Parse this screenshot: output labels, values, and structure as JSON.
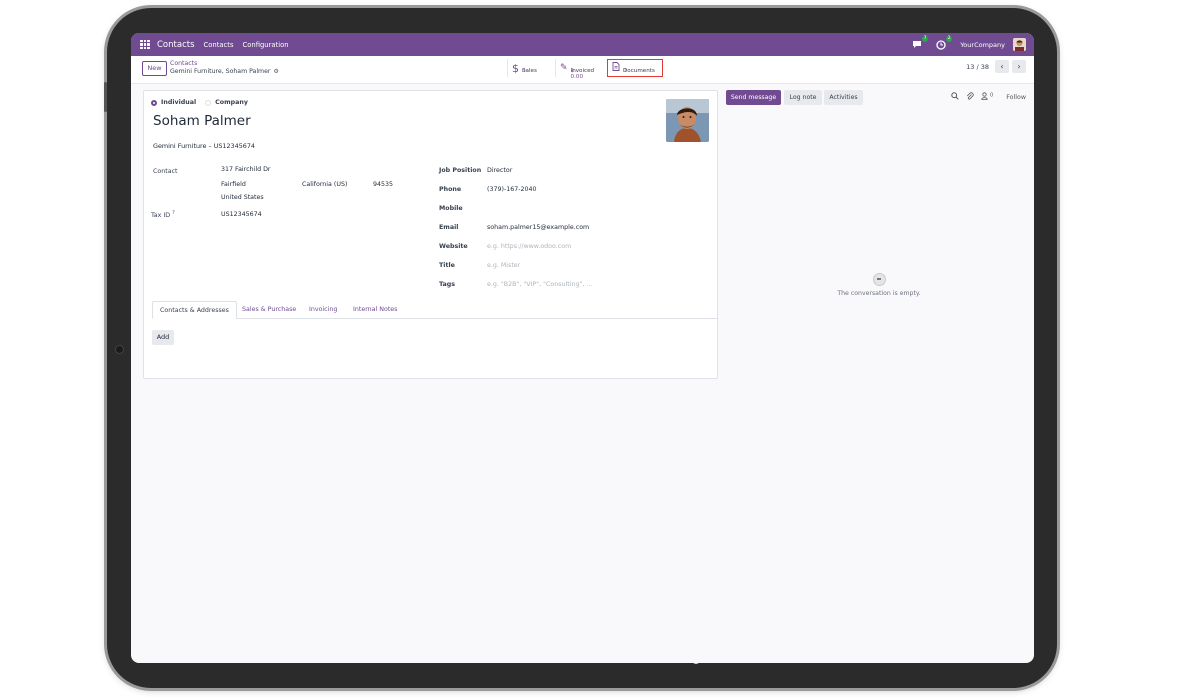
{
  "topbar": {
    "app_name": "Contacts",
    "menu": [
      "Contacts",
      "Configuration"
    ],
    "chat_badge": "7",
    "activity_badge": "2",
    "company": "YourCompany"
  },
  "control_panel": {
    "new_label": "New",
    "breadcrumb_parent": "Contacts",
    "breadcrumb_current": "Gemini Furniture, Soham Palmer",
    "smart_buttons": {
      "sales": {
        "label": "Sales",
        "value": "0"
      },
      "invoiced": {
        "label": "Invoiced",
        "value": "$ 0.00"
      },
      "documents": {
        "label": "Documents",
        "value": "0"
      }
    },
    "pager": "13 / 38"
  },
  "form": {
    "type_individual": "Individual",
    "type_company": "Company",
    "name": "Soham Palmer",
    "company_line": "Gemini Furniture – US12345674",
    "contact_label": "Contact",
    "street": "317 Fairchild Dr",
    "city": "Fairfield",
    "state": "California (US)",
    "zip": "94535",
    "country": "United States",
    "tax_id_label": "Tax ID",
    "tax_id_help": "?",
    "tax_id": "US12345674",
    "job_position_label": "Job Position",
    "job_position": "Director",
    "phone_label": "Phone",
    "phone": "(379)-167-2040",
    "mobile_label": "Mobile",
    "email_label": "Email",
    "email": "soham.palmer15@example.com",
    "website_label": "Website",
    "website_placeholder": "e.g. https://www.odoo.com",
    "title_label": "Title",
    "title_placeholder": "e.g. Mister",
    "tags_label": "Tags",
    "tags_placeholder": "e.g. \"B2B\", \"VIP\", \"Consulting\", ...",
    "tabs": [
      "Contacts & Addresses",
      "Sales & Purchase",
      "Invoicing",
      "Internal Notes"
    ],
    "add_label": "Add"
  },
  "chatter": {
    "send_message": "Send message",
    "log_note": "Log note",
    "activities": "Activities",
    "followers_count": "0",
    "follow": "Follow",
    "empty_text": "The conversation is empty."
  },
  "colors": {
    "brand": "#714b92",
    "highlight": "#e53935"
  }
}
